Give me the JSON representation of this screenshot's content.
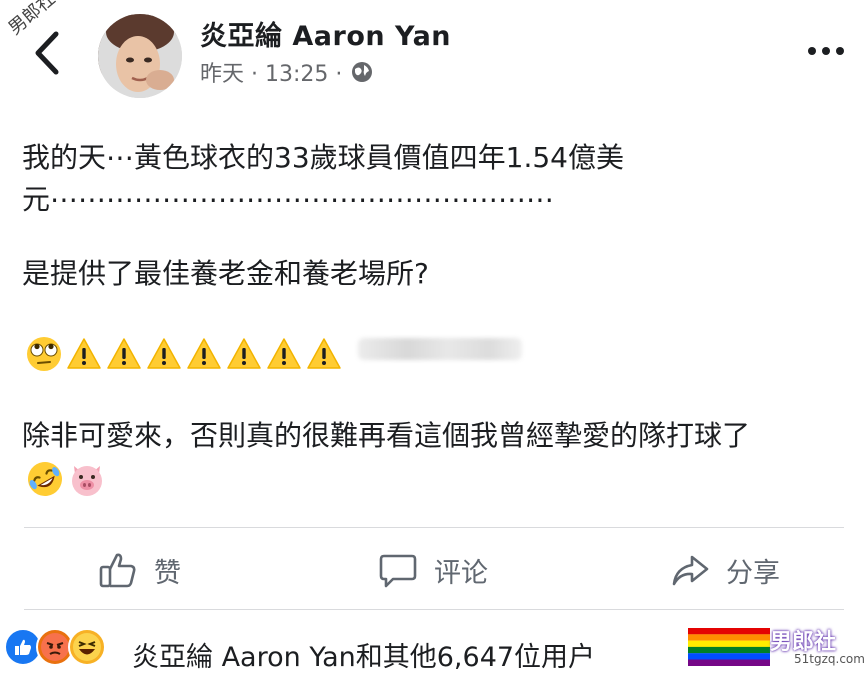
{
  "header": {
    "author": "炎亞綸 Aaron Yan",
    "time_label": "昨天 · 13:25 ·",
    "privacy_icon": "globe-icon"
  },
  "watermark": {
    "top_left": "男郎社",
    "brand": "男郎社",
    "site": "51tgzq.com"
  },
  "post": {
    "line1": "我的天⋯黃色球衣的33歲球員價值四年1.54億美",
    "line2": "元⋯⋯⋯⋯⋯⋯⋯⋯⋯⋯⋯⋯⋯⋯⋯⋯⋯⋯",
    "line3": "是提供了最佳養老金和養老場所?",
    "line4": "除非可愛來，否則真的很難再看這個我曾經摯愛的隊打球了",
    "emoji_row1": [
      "face-with-rolling-eyes",
      "warning",
      "warning",
      "warning",
      "warning",
      "warning",
      "warning",
      "warning"
    ],
    "emoji_row2": [
      "rolling-on-the-floor-laughing",
      "pig-face"
    ]
  },
  "actions": {
    "like": "赞",
    "comment": "评论",
    "share": "分享"
  },
  "reactions": {
    "icons": [
      "like",
      "angry",
      "haha"
    ],
    "summary": "炎亞綸 Aaron Yan和其他6,647位用户"
  },
  "colors": {
    "text": "#1c1e21",
    "muted": "#65676b",
    "like_blue": "#1877f2",
    "warning_yellow": "#ffcc33"
  }
}
